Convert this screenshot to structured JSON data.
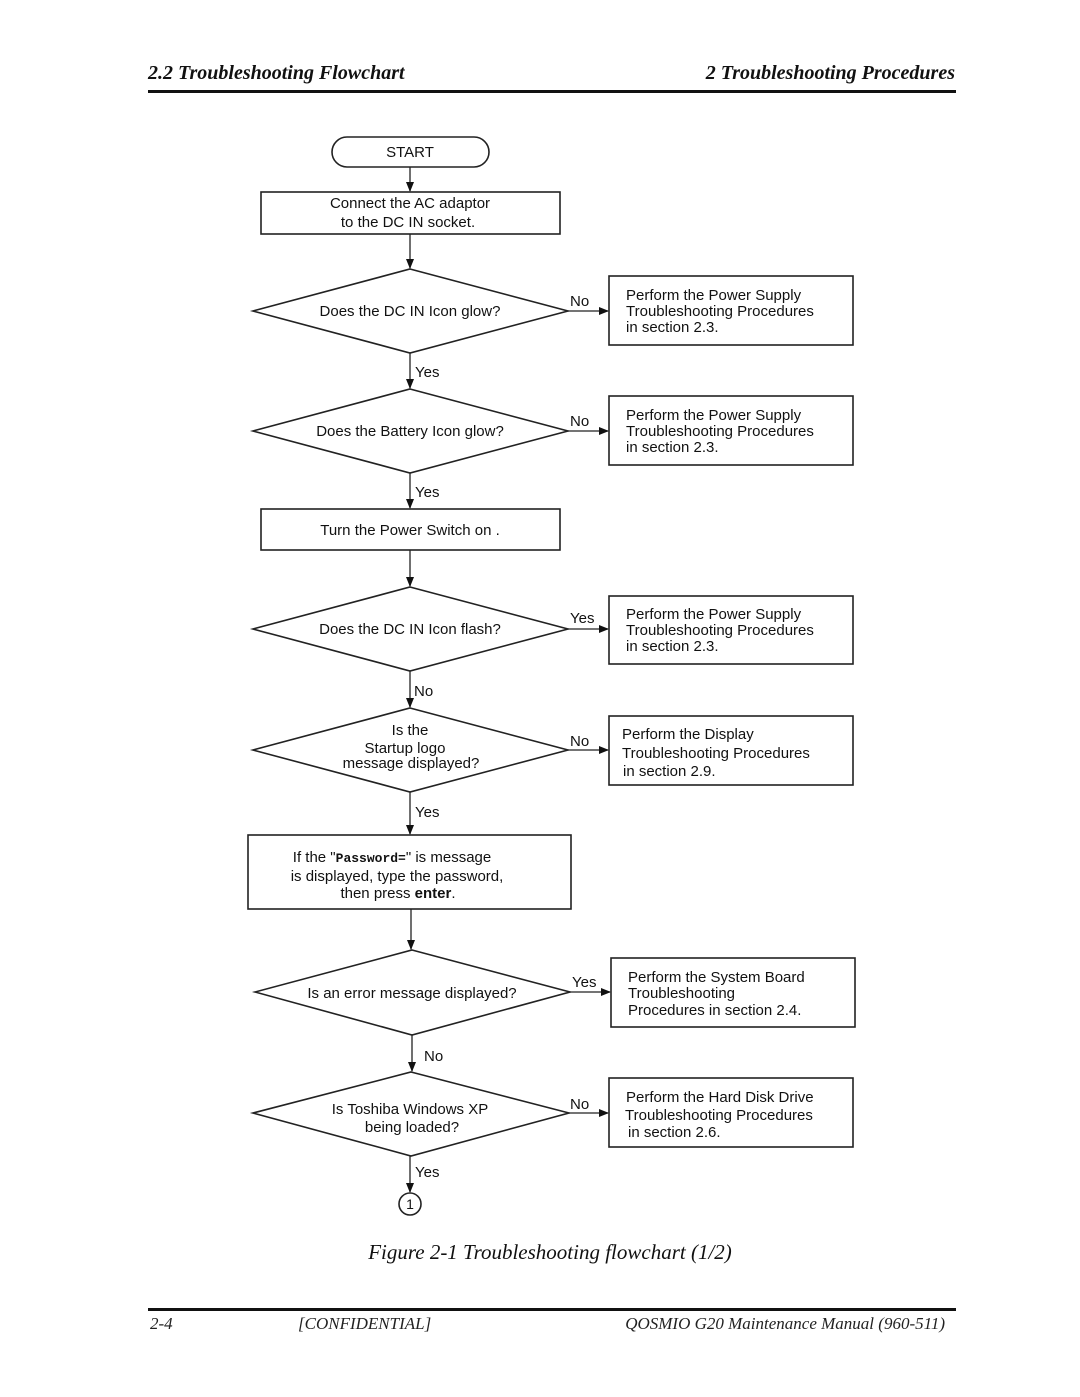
{
  "header": {
    "left": "2.2  Troubleshooting Flowchart",
    "right": "2  Troubleshooting Procedures"
  },
  "flowchart": {
    "start": "START",
    "steps": {
      "connect_ac": [
        "Connect the AC adaptor",
        "to the DC IN socket."
      ],
      "dc_in_glow": [
        "Does the DC IN Icon glow?"
      ],
      "battery_glow": [
        "Does the Battery Icon glow?"
      ],
      "power_on": [
        "Turn the Power Switch on ."
      ],
      "dc_in_flash": [
        "Does the DC IN Icon flash?"
      ],
      "startup_logo": [
        "Is the",
        "Startup  logo",
        "message displayed?"
      ],
      "password": {
        "line1_pre": "If the \"",
        "line1_code": "Password=",
        "line1_post": "\" is message",
        "line2": "is displayed, type the password,",
        "line3_pre": "then press ",
        "line3_bold": "enter",
        "line3_post": "."
      },
      "error_msg": [
        "Is an error message displayed?"
      ],
      "windows_loaded": [
        "Is Toshiba Windows XP",
        "being loaded?"
      ]
    },
    "actions": {
      "power_supply_1": [
        "Perform the Power Supply",
        "Troubleshooting Procedures",
        "in section 2.3."
      ],
      "power_supply_2": [
        "Perform the Power Supply",
        "Troubleshooting Procedures",
        "in section 2.3."
      ],
      "power_supply_3": [
        "Perform the Power Supply",
        "Troubleshooting Procedures",
        "in section 2.3."
      ],
      "display": [
        "Perform the Display",
        "Troubleshooting Procedures",
        "in section 2.9."
      ],
      "system_board": [
        "Perform the System Board",
        "Troubleshooting",
        "Procedures in section 2.4."
      ],
      "hdd": [
        "Perform the Hard Disk Drive",
        "Troubleshooting Procedures",
        "in section 2.6."
      ]
    },
    "labels": {
      "dc_in_glow_no": "No",
      "dc_in_glow_yes": "Yes",
      "battery_glow_no": "No",
      "battery_glow_yes": "Yes",
      "dc_in_flash_yes": "Yes",
      "dc_in_flash_no": "No",
      "startup_logo_no": "No",
      "startup_logo_yes": "Yes",
      "error_msg_yes": "Yes",
      "error_msg_no": "No",
      "windows_loaded_no": "No",
      "windows_loaded_yes": "Yes"
    },
    "connector": "1"
  },
  "caption": "Figure 2-1  Troubleshooting flowchart (1/2)",
  "footer": {
    "page": "2-4",
    "confidential": "[CONFIDENTIAL]",
    "manual": "QOSMIO G20  Maintenance Manual (960-511)"
  }
}
